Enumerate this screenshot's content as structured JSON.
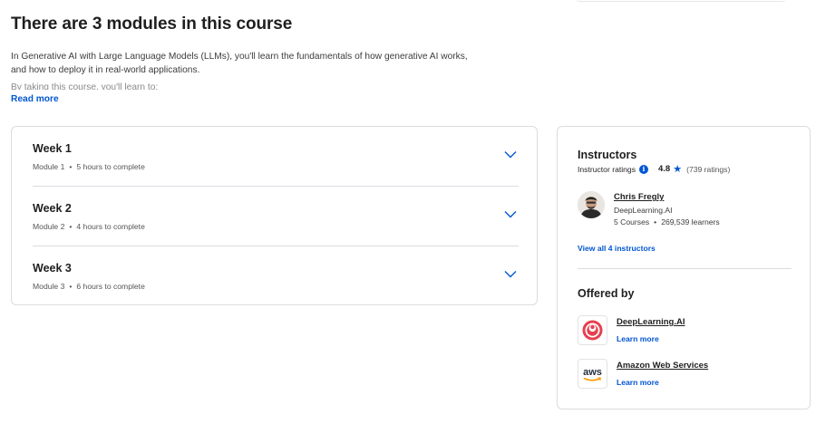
{
  "page_title": "There are 3 modules in this course",
  "description": {
    "paragraph": "In Generative AI with Large Language Models (LLMs), you'll learn the fundamentals of how generative AI works, and how to deploy it in real-world applications.",
    "faded_line": "By taking this course, you'll learn to:",
    "read_more": "Read more"
  },
  "modules": [
    {
      "title": "Week 1",
      "module_label": "Module 1",
      "duration": "5 hours to complete"
    },
    {
      "title": "Week 2",
      "module_label": "Module 2",
      "duration": "4 hours to complete"
    },
    {
      "title": "Week 3",
      "module_label": "Module 3",
      "duration": "6 hours to complete"
    }
  ],
  "instructors": {
    "title": "Instructors",
    "ratings_label": "Instructor ratings",
    "rating_value": "4.8",
    "rating_count": "(739 ratings)",
    "instructor": {
      "name": "Chris Fregly",
      "org": "DeepLearning.AI",
      "courses": "5 Courses",
      "learners": "269,539 learners"
    },
    "view_all": "View all 4 instructors"
  },
  "offered_by": {
    "title": "Offered by",
    "orgs": [
      {
        "name": "DeepLearning.AI",
        "learn_more": "Learn more"
      },
      {
        "name": "Amazon Web Services",
        "learn_more": "Learn more",
        "logo_text": "aws"
      }
    ]
  },
  "colors": {
    "link": "#0056d2",
    "border": "#dadce0",
    "deeplearning_red": "#e6404f",
    "aws_orange": "#ff9900"
  }
}
